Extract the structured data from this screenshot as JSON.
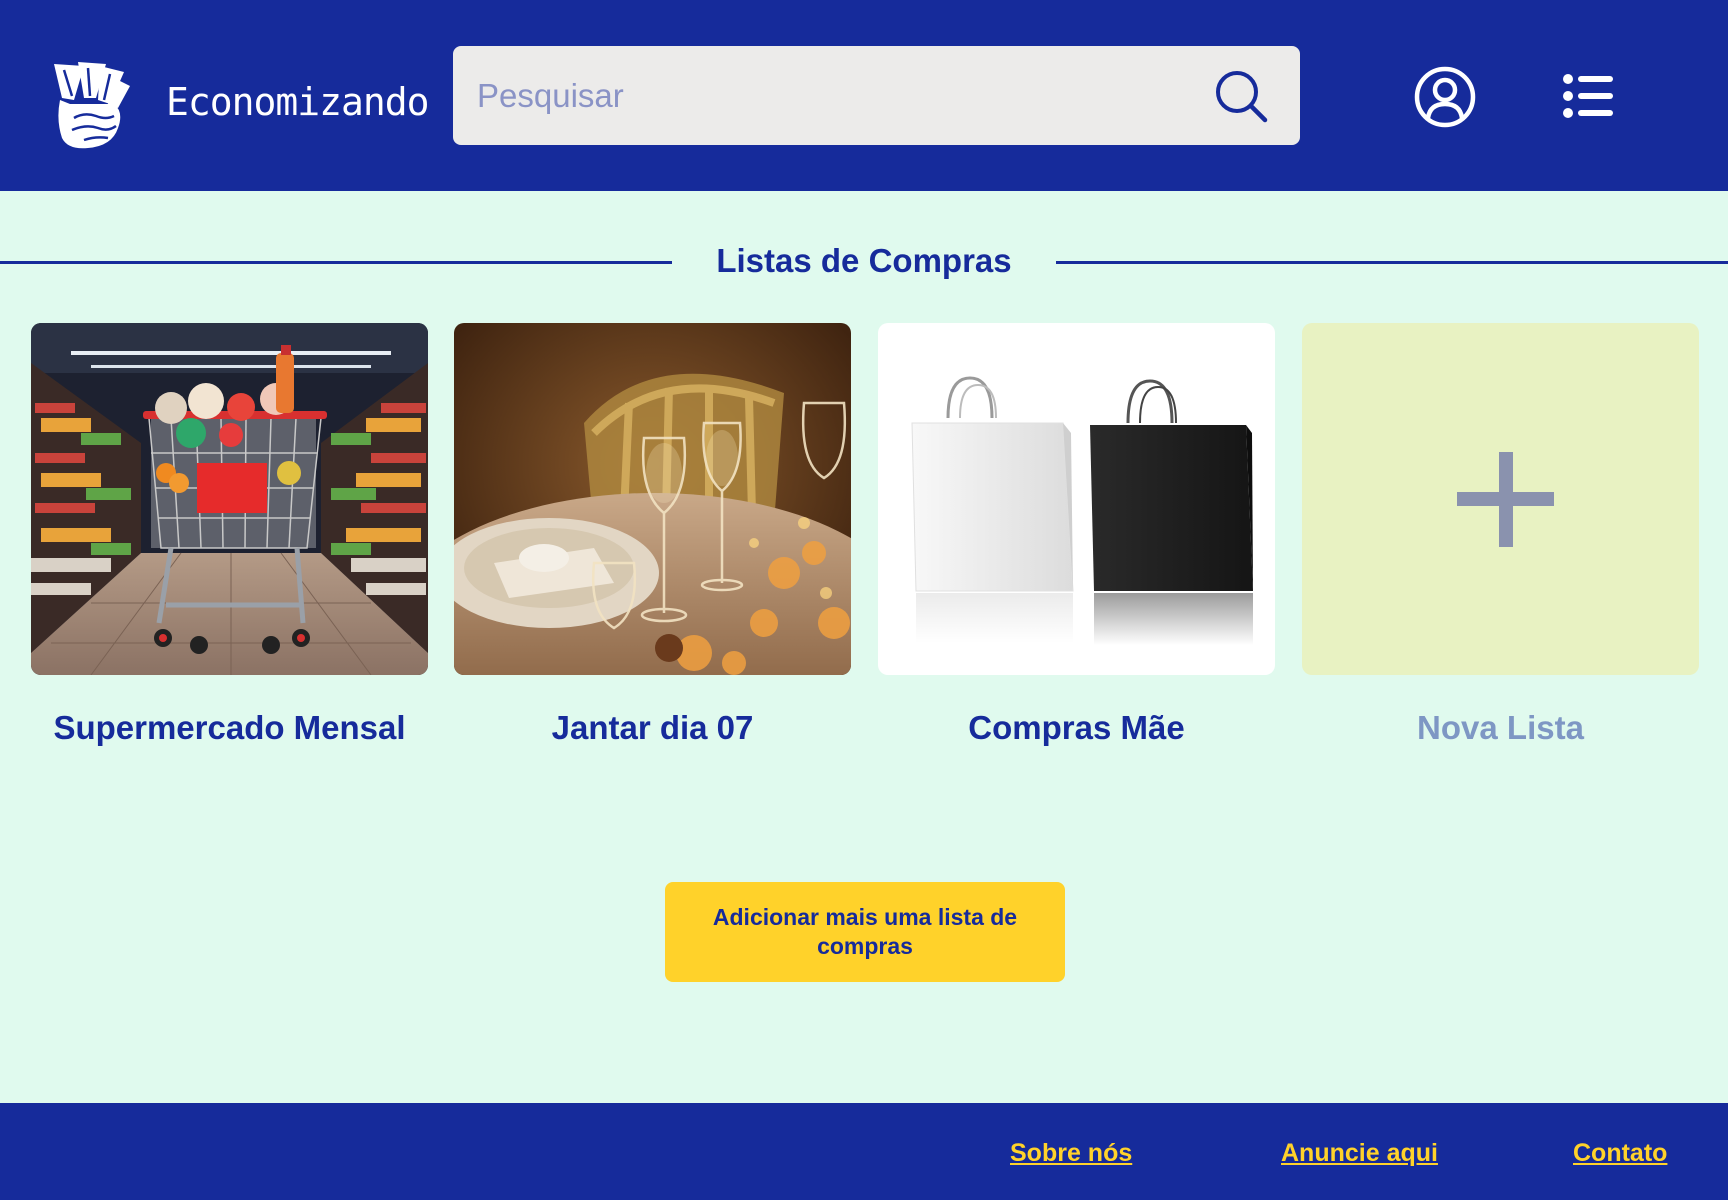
{
  "header": {
    "brand": "Economizando",
    "search_placeholder": "Pesquisar",
    "icons": [
      "logo-icon",
      "search-icon",
      "user-icon",
      "menu-icon"
    ]
  },
  "section": {
    "title": "Listas de Compras"
  },
  "lists": [
    {
      "label": "Supermercado Mensal",
      "image": "supermarket-cart"
    },
    {
      "label": "Jantar dia 07",
      "image": "dinner-table"
    },
    {
      "label": "Compras Mãe",
      "image": "shopping-bags"
    },
    {
      "label": "Nova Lista",
      "image": "plus-icon"
    }
  ],
  "cta": {
    "label": "Adicionar mais uma lista de compras"
  },
  "footer": {
    "links": [
      "Sobre nós",
      "Anuncie aqui",
      "Contato"
    ]
  },
  "colors": {
    "primary": "#162b9b",
    "background": "#e0faee",
    "accent": "#ffd22a",
    "search_bg": "#ecebea",
    "new_card_bg": "#e8f2c2"
  }
}
